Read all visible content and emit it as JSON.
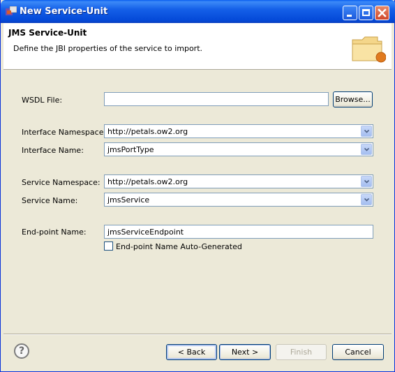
{
  "window": {
    "title": "New Service-Unit"
  },
  "header": {
    "title": "JMS Service-Unit",
    "description": "Define the JBI properties of the service to import."
  },
  "form": {
    "wsdl_label": "WSDL File:",
    "wsdl_value": "",
    "browse_label": "Browse...",
    "interface_namespace_label": "Interface Namespace:",
    "interface_namespace_value": "http://petals.ow2.org",
    "interface_name_label": "Interface Name:",
    "interface_name_value": "jmsPortType",
    "service_namespace_label": "Service Namespace:",
    "service_namespace_value": "http://petals.ow2.org",
    "service_name_label": "Service Name:",
    "service_name_value": "jmsService",
    "endpoint_name_label": "End-point Name:",
    "endpoint_name_value": "jmsServiceEndpoint",
    "endpoint_auto_label": "End-point Name Auto-Generated",
    "endpoint_auto_checked": false
  },
  "footer": {
    "help_glyph": "?",
    "back_label": "< Back",
    "next_label": "Next >",
    "finish_label": "Finish",
    "cancel_label": "Cancel"
  },
  "colors": {
    "titlebar": "#0449d8",
    "dialog_bg": "#ece9d8",
    "field_border": "#7f9db9"
  }
}
